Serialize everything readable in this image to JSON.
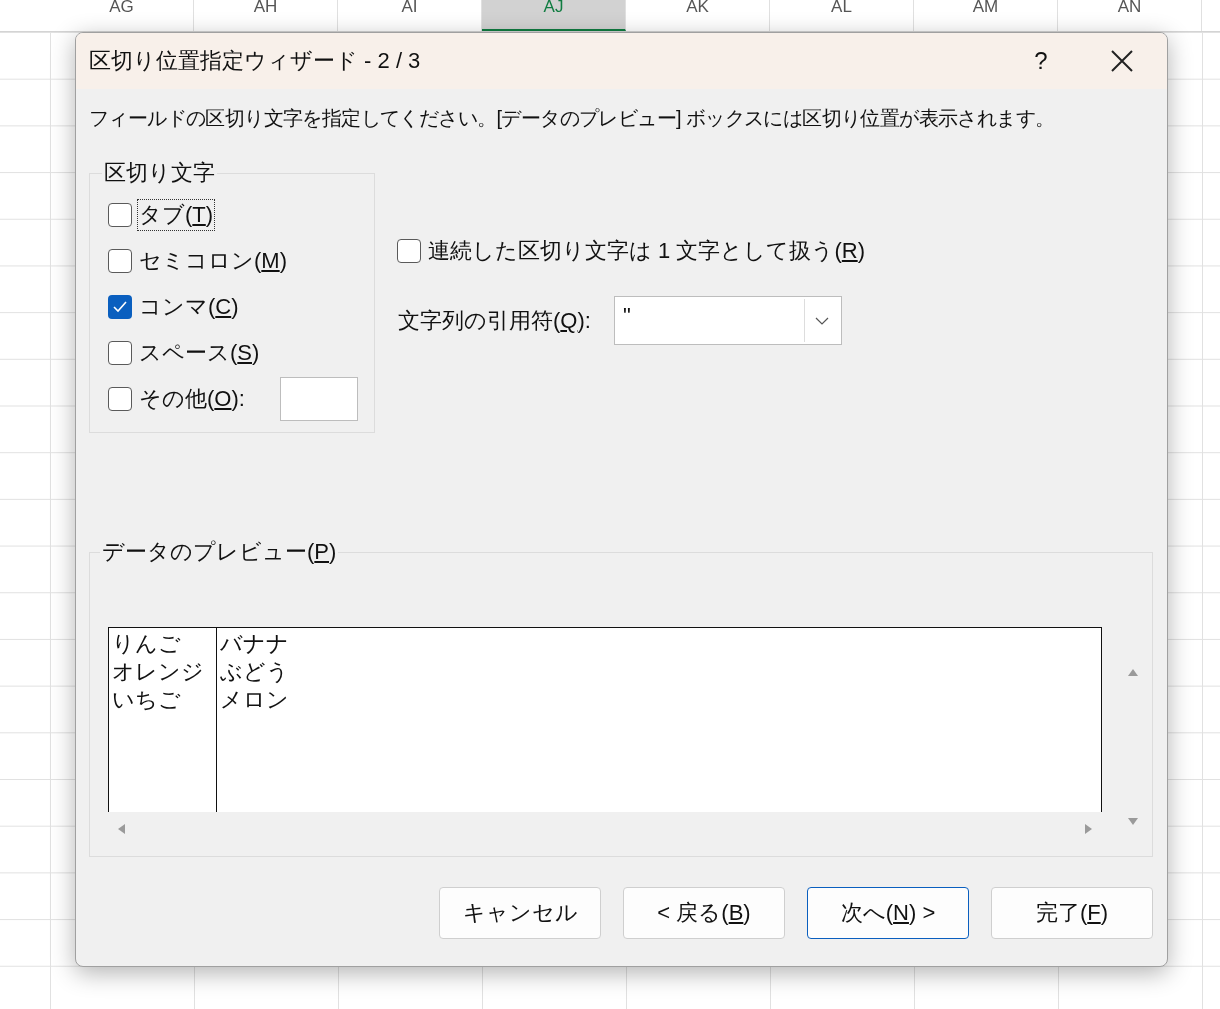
{
  "sheet": {
    "column_headers": [
      {
        "label": "AG",
        "selected": false
      },
      {
        "label": "AH",
        "selected": false
      },
      {
        "label": "AI",
        "selected": false
      },
      {
        "label": "AJ",
        "selected": true
      },
      {
        "label": "AK",
        "selected": false
      },
      {
        "label": "AL",
        "selected": false
      },
      {
        "label": "AM",
        "selected": false
      },
      {
        "label": "AN",
        "selected": false
      }
    ]
  },
  "dialog": {
    "title": "区切り位置指定ウィザード - 2 / 3",
    "help": "?",
    "instruction": "フィールドの区切り文字を指定してください。[データのプレビュー] ボックスには区切り位置が表示されます。",
    "delimiters": {
      "title": "区切り文字",
      "items": [
        {
          "kind": "checkbox",
          "label_before": "タブ(",
          "key": "T",
          "label_after": ")",
          "checked": false,
          "focused": true
        },
        {
          "kind": "checkbox",
          "label_before": "セミコロン(",
          "key": "M",
          "label_after": ")",
          "checked": false,
          "focused": false
        },
        {
          "kind": "checkbox",
          "label_before": "コンマ(",
          "key": "C",
          "label_after": ")",
          "checked": true,
          "focused": false
        },
        {
          "kind": "checkbox",
          "label_before": "スペース(",
          "key": "S",
          "label_after": ")",
          "checked": false,
          "focused": false
        },
        {
          "kind": "checkbox-with-field",
          "label_before": "その他(",
          "key": "O",
          "label_after": "):",
          "checked": false,
          "focused": false
        }
      ]
    },
    "consecutive": {
      "label_before": "連続した区切り文字は 1 文字として扱う(",
      "key": "R",
      "label_after": ")",
      "checked": false
    },
    "quote": {
      "label_before": "文字列の引用符(",
      "key": "Q",
      "label_after": "):",
      "value": "\""
    },
    "preview": {
      "title_before": "データのプレビュー(",
      "key": "P",
      "title_after": ")",
      "columns": [
        {
          "cells": [
            "りんご",
            "オレンジ",
            "いちご"
          ]
        },
        {
          "cells": [
            "バナナ",
            "ぶどう",
            "メロン"
          ]
        }
      ]
    },
    "buttons": [
      {
        "label_before": "キャンセル",
        "default": false
      },
      {
        "label_before": "< 戻る(",
        "key": "B",
        "label_after": ")",
        "default": false
      },
      {
        "label_before": "次へ(",
        "key": "N",
        "label_after": ") >",
        "default": true
      },
      {
        "label_before": "完了(",
        "key": "F",
        "label_after": ")",
        "default": false
      }
    ]
  }
}
